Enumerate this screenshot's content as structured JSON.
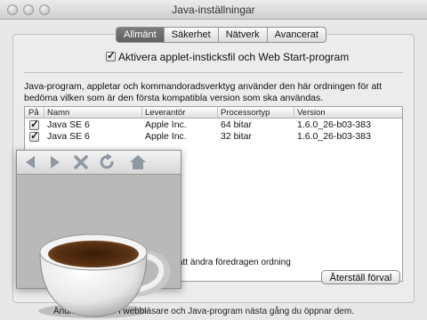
{
  "window": {
    "title": "Java-inställningar"
  },
  "tabs": [
    {
      "label": "Allmänt",
      "active": true
    },
    {
      "label": "Säkerhet",
      "active": false
    },
    {
      "label": "Nätverk",
      "active": false
    },
    {
      "label": "Avancerat",
      "active": false
    }
  ],
  "general": {
    "applet_checkbox_label": "Aktivera applet-insticksfil och Web Start-program",
    "applet_checked": true,
    "description": "Java-program, appletar och kommandoradsverktyg använder den här ordningen för att bedöma vilken som är den första kompatibla version som ska användas."
  },
  "table": {
    "columns": [
      "På",
      "Namn",
      "Leverantör",
      "Processortyp",
      "Version"
    ],
    "rows": [
      {
        "enabled": true,
        "name": "Java SE 6",
        "vendor": "Apple Inc.",
        "arch": "64 bitar",
        "version": "1.6.0_26-b03-383"
      },
      {
        "enabled": true,
        "name": "Java SE 6",
        "vendor": "Apple Inc.",
        "arch": "32 bitar",
        "version": "1.6.0_26-b03-383"
      }
    ]
  },
  "drag_hint": "att ändra föredragen ordning",
  "buttons": {
    "reset": "Återställ förval"
  },
  "footer": "Ändringar gäller i webbläsare och Java-program nästa gång du öppnar dem.",
  "overlay": {
    "toolbar_icons": [
      "back-arrow-icon",
      "forward-arrow-icon",
      "stop-x-icon",
      "reload-icon",
      "home-icon"
    ],
    "logo": "java-coffee-cup-icon"
  }
}
